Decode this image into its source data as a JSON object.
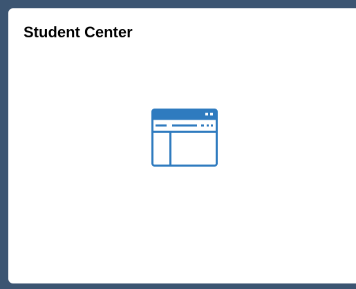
{
  "tile": {
    "title": "Student Center",
    "icon": "application-window-icon",
    "accent_color": "#2f7bbf",
    "frame_color": "#3c5572"
  }
}
